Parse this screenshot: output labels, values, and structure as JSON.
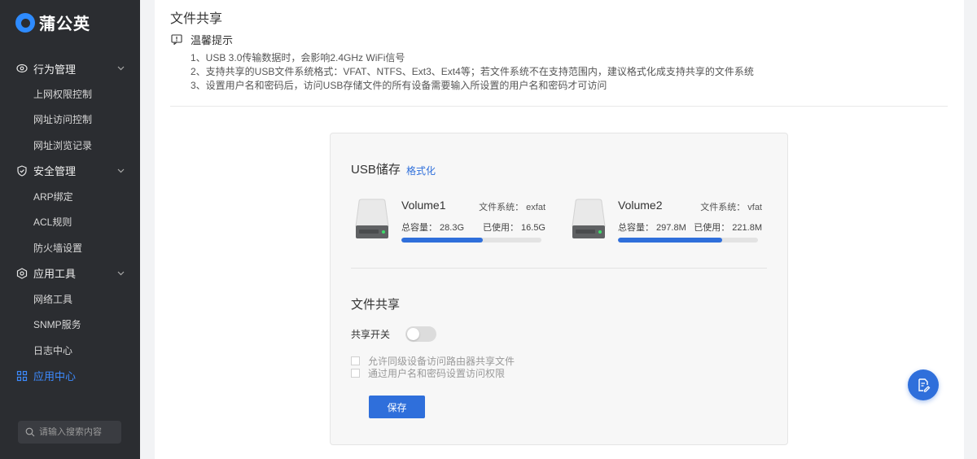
{
  "app": {
    "logo_text": "蒲公英"
  },
  "sidebar": {
    "groups": [
      {
        "label": "行为管理",
        "icon": "eye-icon",
        "items": [
          "上网权限控制",
          "网址访问控制",
          "网址浏览记录"
        ]
      },
      {
        "label": "安全管理",
        "icon": "shield-icon",
        "items": [
          "ARP绑定",
          "ACL规则",
          "防火墙设置"
        ]
      },
      {
        "label": "应用工具",
        "icon": "tools-icon",
        "items": [
          "网络工具",
          "SNMP服务",
          "日志中心"
        ]
      }
    ],
    "active_item": {
      "label": "应用中心",
      "icon": "apps-grid-icon"
    },
    "search_placeholder": "请输入搜索内容"
  },
  "page": {
    "title": "文件共享",
    "tip_title": "温馨提示",
    "tips": [
      "1、USB 3.0传输数据时，会影响2.4GHz WiFi信号",
      "2、支持共享的USB文件系统格式：VFAT、NTFS、Ext3、Ext4等；若文件系统不在支持范围内，建议格式化成支持共享的文件系统",
      "3、设置用户名和密码后，访问USB存储文件的所有设备需要输入所设置的用户名和密码才可访问"
    ]
  },
  "usb": {
    "title": "USB储存",
    "format_label": "格式化",
    "volumes": [
      {
        "name": "Volume1",
        "fs": "文件系统： exfat",
        "total": "总容量： 28.3G",
        "used": "已使用： 16.5G",
        "usage_fraction": 0.583
      },
      {
        "name": "Volume2",
        "fs": "文件系统： vfat",
        "total": "总容量： 297.8M",
        "used": "已使用： 221.8M",
        "usage_fraction": 0.745
      }
    ]
  },
  "share": {
    "title": "文件共享",
    "toggle_label": "共享开关",
    "toggle_on": false,
    "options": [
      "允许同级设备访问路由器共享文件",
      "通过用户名和密码设置访问权限"
    ],
    "save_label": "保存"
  },
  "colors": {
    "accent": "#2f6fdb",
    "sidebar_bg": "#2b2d31",
    "active": "#3d8bff"
  }
}
